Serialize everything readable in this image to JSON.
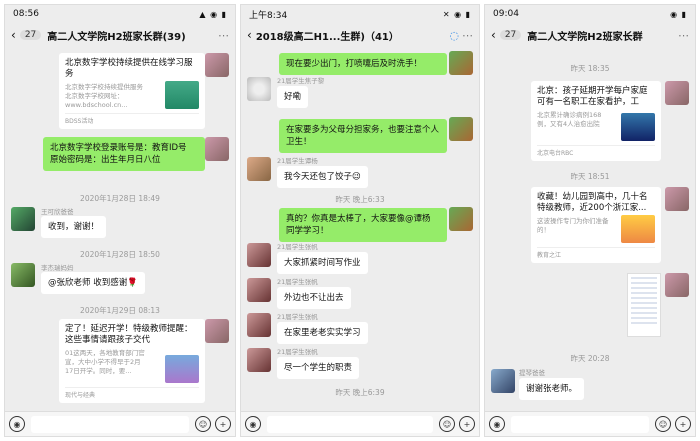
{
  "panel1": {
    "status_time": "08:56",
    "status_icons": "▲ ◉ ▮",
    "back": "‹",
    "count": "27",
    "title": "高二人文学院H2班家长群(39)",
    "card1": {
      "title": "北京数字学校持续提供在线学习服务",
      "desc": "北京数字学校持续提供服务北京数字学校网址：www.bdschool.cn...",
      "source": "BDSS活动"
    },
    "msg_login": "北京数字学校登录账号是：教育ID号\n原始密码是：出生年月日八位",
    "ts1": "2020年1月28日 18:49",
    "sender1": "王可欣爸爸",
    "msg_received": "收到，谢谢！",
    "ts2": "2020年1月28日 18:50",
    "sender2": "李杰瑞妈妈",
    "msg_thanks": "@张欣老师 收到感谢🌹",
    "ts3": "2020年1月29日 08:13",
    "card2": {
      "title": "定了！延迟开学！特级教师提醒：这些事情请跟孩子交代",
      "desc": "01这两天，各地教育部门官宣，大中小学不得早于2月17日开学。同时，要...",
      "source": "现代与经典"
    }
  },
  "panel2": {
    "status_time": "上午8:34",
    "status_icons": "✕ ◉ ▮",
    "back": "‹",
    "title": "2018级高二H1...生群)（41）",
    "msg1": "现在要少出门，打喷嚏后及时洗手！",
    "sender1": "21届学生焦子黎",
    "msg2": "好嘞",
    "msg3": "在家要多为父母分担家务，也要注意个人卫生！",
    "sender2": "21届学生谭杨",
    "msg4": "我今天还包了饺子😉",
    "ts1": "昨天 晚上6:33",
    "msg5": "真的？你真是太棒了，大家要像@谭杨 同学学习！",
    "sender3": "21届学生张帆",
    "msg6": "大家抓紧时间写作业",
    "sender4": "21届学生张帆",
    "msg7": "外边也不让出去",
    "sender5": "21届学生张帆",
    "msg8": "在家里老老实实学习",
    "sender6": "21届学生张帆",
    "msg9": "尽一个学生的职责",
    "ts2": "昨天 晚上6:39"
  },
  "panel3": {
    "status_time": "09:04",
    "status_icons": "◉ ▮",
    "back": "‹",
    "count": "27",
    "title": "高二人文学院H2班家长群",
    "ts1": "昨天 18:35",
    "card1": {
      "title": "北京：孩子延期开学每户家庭可有一名职工在家看护，工",
      "desc": "北京累计确诊病例168例，又有4人治愈出院",
      "source": "北京电台RBC"
    },
    "ts2": "昨天 18:51",
    "card2": {
      "title": "收藏！幼儿园到高中，几十名特级教师，近200个浙江家...",
      "desc": "这波操作专门为你们准备的！",
      "source": "教育之江"
    },
    "ts3": "昨天 20:28",
    "sender1": "提琴爸爸",
    "msg1": "谢谢张老师。"
  },
  "input": {
    "voice": "◉",
    "emoji": "☺",
    "plus": "+"
  },
  "colors": {
    "green_bubble": "#95ec69",
    "chat_bg": "#ededed"
  }
}
